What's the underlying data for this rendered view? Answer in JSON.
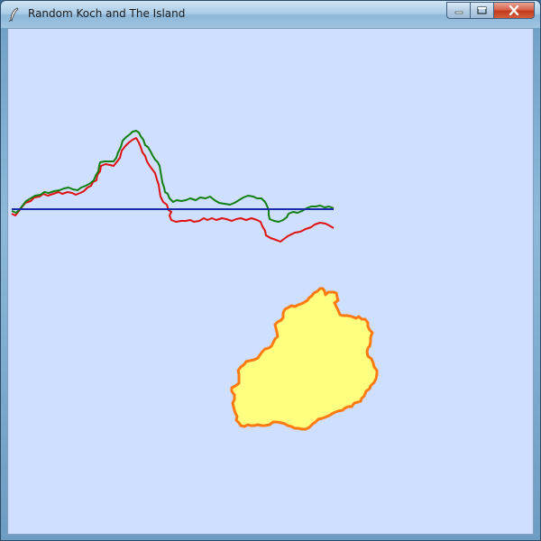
{
  "window": {
    "title": "Random Koch and The Island",
    "icon": "feather-icon"
  },
  "controls": {
    "minimize_icon": "minimize-icon",
    "maximize_icon": "maximize-icon",
    "close_icon": "close-icon"
  },
  "colors": {
    "canvas_bg": "#cfdfff",
    "baseline": "#1a2aa8",
    "green_curve": "#108010",
    "red_curve": "#e01010",
    "island_fill": "#ffff80",
    "island_outline": "#ff7a10"
  }
}
